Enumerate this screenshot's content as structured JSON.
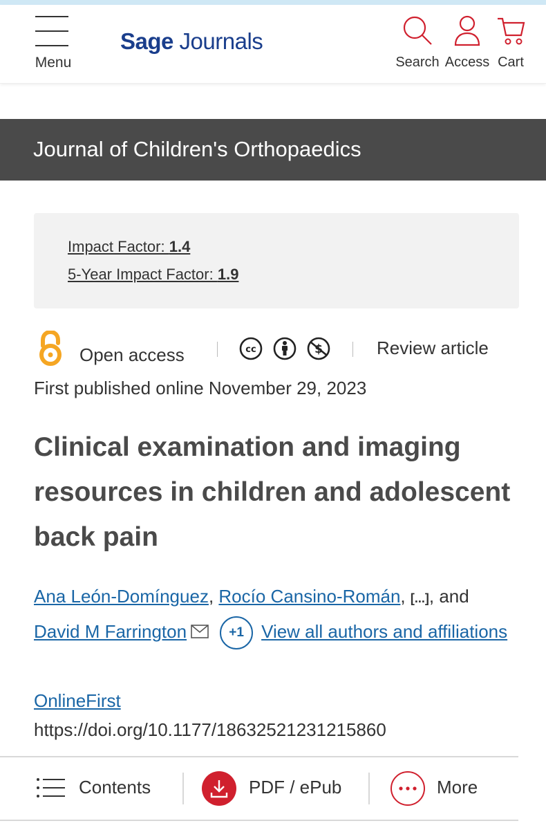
{
  "header": {
    "menu_label": "Menu",
    "logo_part1": "Sage",
    "logo_part2": "Journals",
    "search_label": "Search",
    "access_label": "Access",
    "cart_label": "Cart"
  },
  "journal": {
    "title": "Journal of Children's Orthopaedics"
  },
  "impact": {
    "if_label": "Impact Factor: ",
    "if_value": "1.4",
    "if5_label": "5-Year Impact Factor: ",
    "if5_value": "1.9"
  },
  "meta": {
    "open_access": "Open access",
    "article_type": "Review article",
    "published": "First published online November 29, 2023"
  },
  "article": {
    "title": "Clinical examination and imaging resources in children and adolescent back pain"
  },
  "authors": {
    "a1": "Ana León-Domínguez",
    "a2": "Rocío Cansino-Román",
    "ellipsis": "[...]",
    "and": ", and",
    "a3": "David M Farrington",
    "more_count": "+1",
    "view_all": "View all authors and affiliations"
  },
  "pub": {
    "status": "OnlineFirst",
    "doi": "https://doi.org/10.1177/18632521231215860"
  },
  "bottom_bar": {
    "contents": "Contents",
    "pdf": "PDF / ePub",
    "more": "More"
  },
  "colors": {
    "brand": "#1a3e8c",
    "link": "#1a66a6",
    "accent_red": "#d0202e",
    "open_access_orange": "#f5a623",
    "journal_bar": "#4a4a4a"
  }
}
